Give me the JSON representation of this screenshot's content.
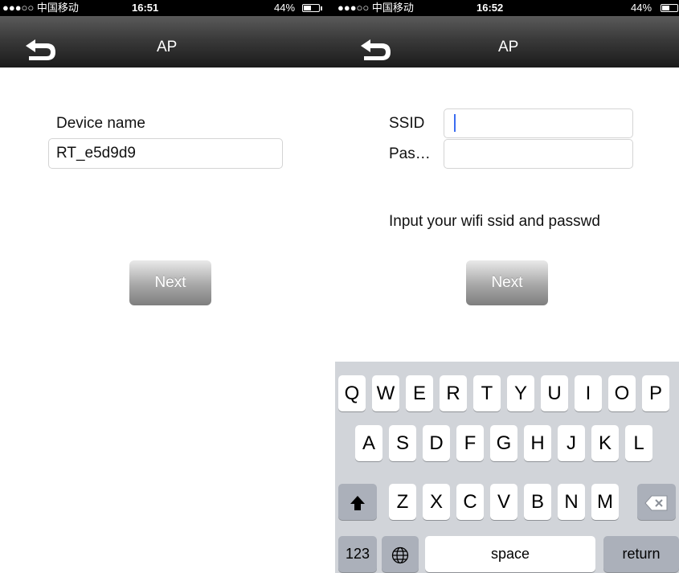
{
  "left": {
    "status": {
      "carrier": "●●●○○ 中国移动",
      "time": "16:51",
      "battery": "44%"
    },
    "nav": {
      "title": "AP"
    },
    "device_name_label": "Device name",
    "device_name_value": "RT_e5d9d9",
    "next_label": "Next"
  },
  "right": {
    "status": {
      "carrier": "●●●○○ 中国移动",
      "time": "16:52",
      "battery": "44%"
    },
    "nav": {
      "title": "AP"
    },
    "ssid_label": "SSID",
    "ssid_value": "",
    "password_label": "Pas…",
    "password_value": "",
    "hint": "Input your wifi ssid and passwd",
    "next_label": "Next",
    "keyboard": {
      "row1": [
        "Q",
        "W",
        "E",
        "R",
        "T",
        "Y",
        "U",
        "I",
        "O",
        "P"
      ],
      "row2": [
        "A",
        "S",
        "D",
        "F",
        "G",
        "H",
        "J",
        "K",
        "L"
      ],
      "row3": [
        "Z",
        "X",
        "C",
        "V",
        "B",
        "N",
        "M"
      ],
      "numbers": "123",
      "space": "space",
      "return": "return",
      "shift_icon": "shift-icon",
      "delete_icon": "delete-icon",
      "globe_icon": "globe-icon"
    }
  },
  "colors": {
    "caret": "#3b6cf0",
    "keyboard_bg": "#d1d4d9"
  }
}
